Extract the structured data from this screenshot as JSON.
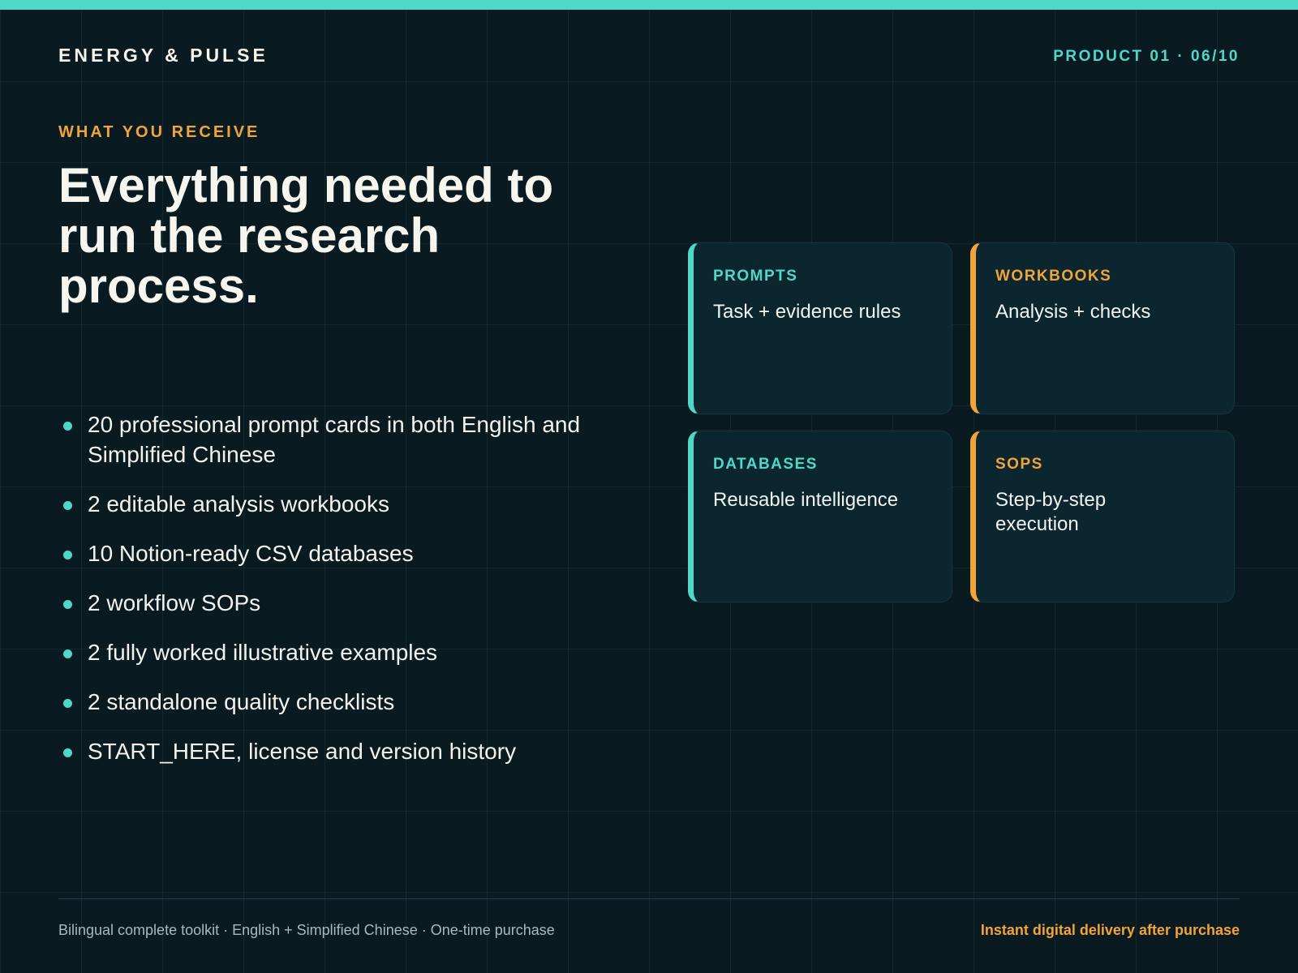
{
  "brand": "ENERGY & PULSE",
  "page_counter": "PRODUCT 01 · 06/10",
  "eyebrow": "WHAT YOU RECEIVE",
  "headline": "Everything needed to run the research process.",
  "benefits": [
    "20 professional prompt cards in both English and Simplified Chinese",
    "2 editable analysis workbooks",
    "10 Notion-ready CSV databases",
    "2 workflow SOPs",
    "2 fully worked illustrative examples",
    "2 standalone quality checklists",
    "START_HERE, license and version history"
  ],
  "cards": [
    {
      "title": "PROMPTS",
      "description": "Task + evidence rules",
      "accent": "#4fd8c8"
    },
    {
      "title": "WORKBOOKS",
      "description": "Analysis + checks",
      "accent": "#f0a43a"
    },
    {
      "title": "DATABASES",
      "description": "Reusable intelligence",
      "accent": "#4fd8c8"
    },
    {
      "title": "SOPS",
      "description": "Step-by-step execution",
      "accent": "#f0a43a"
    }
  ],
  "footer": {
    "left": "Bilingual complete toolkit · English + Simplified Chinese · One-time purchase",
    "right": "Instant digital delivery after purchase"
  },
  "colors": {
    "background": "#0a1a21",
    "teal_accent": "#4fd8c8",
    "orange_accent": "#f0a43a",
    "card_background": "#0c2630"
  }
}
